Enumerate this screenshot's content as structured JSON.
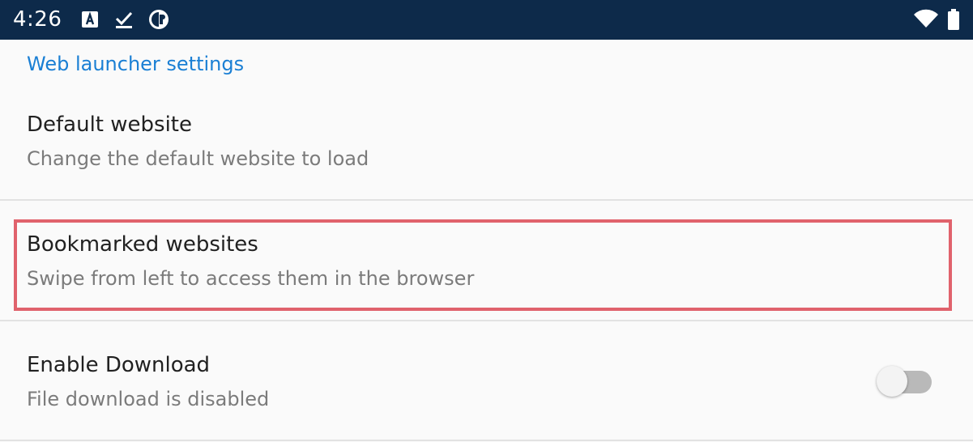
{
  "status_bar": {
    "time": "4:26",
    "icons_left": [
      "notification-a-icon",
      "download-check-icon",
      "circle-app-icon"
    ],
    "icons_right": [
      "wifi-icon",
      "battery-icon"
    ],
    "background": "#0d2a4a"
  },
  "settings": {
    "section_title": "Web launcher settings",
    "items": [
      {
        "title": "Default website",
        "summary": "Change the default website to load"
      },
      {
        "title": "Bookmarked websites",
        "summary": "Swipe from left to access them in the browser",
        "highlighted": true
      },
      {
        "title": "Enable Download",
        "summary": "File download is disabled",
        "switch_on": false
      }
    ]
  },
  "colors": {
    "accent": "#1a7fd4",
    "highlight": "#e0626c"
  }
}
